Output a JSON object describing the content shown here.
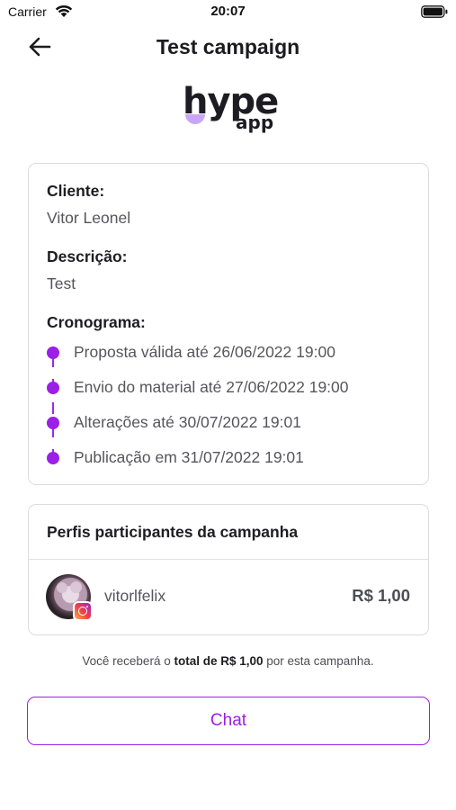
{
  "status_bar": {
    "carrier": "Carrier",
    "time": "20:07"
  },
  "nav": {
    "title": "Test campaign"
  },
  "logo": {
    "word": "hype",
    "sub": "app",
    "accent": "#c9a6f5"
  },
  "info": {
    "client_label": "Cliente:",
    "client_value": "Vitor Leonel",
    "description_label": "Descrição:",
    "description_value": "Test",
    "schedule_label": "Cronograma:",
    "schedule": [
      "Proposta válida até 26/06/2022 19:00",
      "Envio do material até 27/06/2022 19:00",
      "Alterações até 30/07/2022 19:01",
      "Publicação em 31/07/2022 19:01"
    ]
  },
  "profiles": {
    "title": "Perfis participantes da campanha",
    "items": [
      {
        "username": "vitorlfelix",
        "network": "instagram-icon",
        "price": "R$ 1,00"
      }
    ]
  },
  "note": {
    "prefix": "Você receberá o ",
    "bold": "total de R$ 1,00",
    "suffix": " por esta campanha."
  },
  "chat_button": {
    "label": "Chat"
  },
  "colors": {
    "accent": "#9b1fe6",
    "border": "#dcdce0",
    "text": "#1d1d22",
    "muted": "#55555c"
  }
}
